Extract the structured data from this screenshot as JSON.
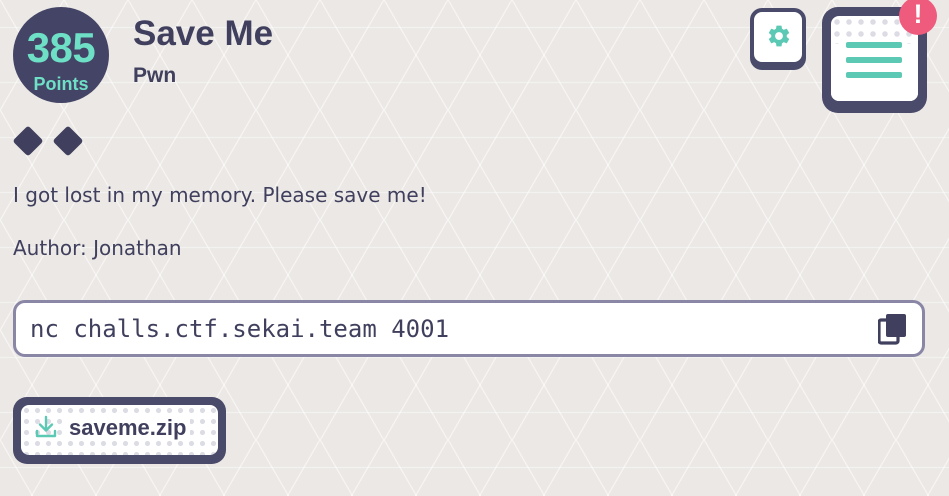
{
  "challenge": {
    "points": "385",
    "points_label": "Points",
    "title": "Save Me",
    "category": "Pwn",
    "difficulty_diamonds": 2,
    "description": "I got lost in my memory. Please save me!",
    "author": "Author: Jonathan"
  },
  "connection": {
    "command": "nc challs.ctf.sekai.team 4001",
    "copy_icon": "copy-icon"
  },
  "toolbar": {
    "settings_icon": "gear-icon",
    "menu_icon": "hamburger-menu-icon",
    "alert_text": "!"
  },
  "attachments": [
    {
      "label": "saveme.zip",
      "icon": "download-icon"
    }
  ],
  "colors": {
    "dark": "#40405e",
    "accent": "#5cc9b4",
    "points_text": "#6ee0c6",
    "alert": "#ee5b7d",
    "border": "#8a86a6"
  }
}
